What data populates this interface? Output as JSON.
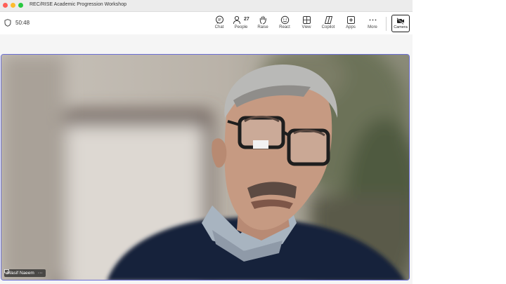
{
  "window": {
    "title": "REC/RISE Academic Progression Workshop"
  },
  "meeting": {
    "timer": "50:48",
    "people_count": "27",
    "toolbar": {
      "chat": "Chat",
      "people": "People",
      "raise": "Raise",
      "react": "React",
      "view": "View",
      "copilot": "Copilot",
      "apps": "Apps",
      "more": "More",
      "camera": "Camera"
    }
  },
  "participant": {
    "name": "Wasif Naeem"
  },
  "colors": {
    "active_speaker_border": "#6b6fd6",
    "camera_button_border": "#1a1a1a"
  },
  "icons": [
    "shield-icon",
    "chat-icon",
    "people-icon",
    "raise-hand-icon",
    "react-icon",
    "view-icon",
    "copilot-icon",
    "apps-icon",
    "more-icon",
    "camera-off-icon",
    "screen-share-icon",
    "ellipsis-icon"
  ]
}
